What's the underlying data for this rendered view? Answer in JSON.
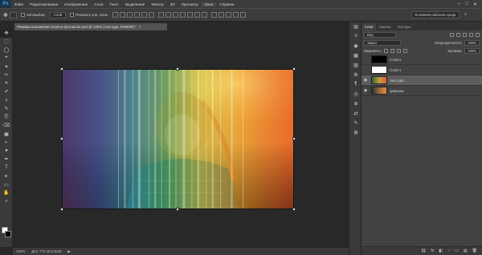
{
  "app": {
    "logo": "Ps"
  },
  "menu": [
    "Файл",
    "Редактирование",
    "Изображение",
    "Слои",
    "Текст",
    "Выделение",
    "Фильтр",
    "3D",
    "Просмотр",
    "Окно",
    "Справка"
  ],
  "window_controls": {
    "minimize": "–",
    "maximize": "□",
    "close": "✕"
  },
  "options": {
    "tool_glyph": "✥",
    "autoselect_label": "Автовыбор:",
    "autoselect_value": "Слой",
    "show_controls_label": "Показать упр. элем."
  },
  "workspace": {
    "label": "Основная рабочая среда",
    "search_glyph": "⌕"
  },
  "document": {
    "tab_title": "Режимы наложения слоев в фотошопе.psd @ 100% (текстура, RGB/8#) *",
    "close_glyph": "×"
  },
  "status": {
    "zoom": "100%",
    "doc_size": "Док: 772.4K/2.94M",
    "arrow": "▶"
  },
  "tools": [
    "✥",
    "⬚",
    "◯",
    "⌖",
    "✦",
    "✂",
    "⌗",
    "✐",
    "⚕",
    "✎",
    "⎘",
    "⌫",
    "▣",
    "◐",
    "●",
    "✒",
    "T",
    "▸",
    "▭",
    "✋",
    "⌕"
  ],
  "dock_icons": [
    "▤",
    "≡",
    "◉",
    "▦",
    "▧",
    "⚙",
    "¶",
    "Ⓐ",
    "⊕",
    "⇄",
    "✎",
    "⊞"
  ],
  "panel": {
    "tabs": [
      "Слои",
      "Каналы",
      "Контуры"
    ],
    "active_tab": "Слои",
    "filter_label": "Вид",
    "blend_mode": "Экран",
    "opacity_label": "Непрозрачность:",
    "opacity_value": "100%",
    "lock_label": "Закрепить:",
    "fill_label": "Заливка:",
    "fill_value": "100%",
    "layers": [
      {
        "name": "Слой 2",
        "visible": false,
        "thumb": "black"
      },
      {
        "name": "Слой 1",
        "visible": false,
        "thumb": "white"
      },
      {
        "name": "текстура",
        "visible": true,
        "thumb": "photo-t",
        "selected": true
      },
      {
        "name": "девушка",
        "visible": true,
        "thumb": "photo-t2"
      }
    ],
    "footer_icons": [
      "⛓",
      "fx",
      "◧",
      "◔",
      "▭",
      "▤",
      "🗑"
    ]
  }
}
